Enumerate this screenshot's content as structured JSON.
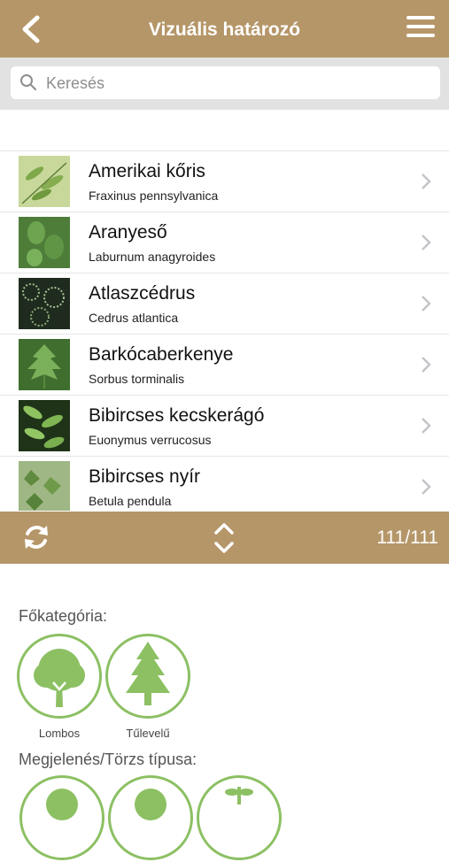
{
  "header": {
    "title": "Vizuális határozó",
    "back_icon": "chevron-left-icon",
    "menu_icon": "hamburger-menu-icon"
  },
  "search": {
    "placeholder": "Keresés"
  },
  "plants": [
    {
      "name": "Amerikai kőris",
      "latin": "Fraxinus pennsylvanica"
    },
    {
      "name": "Aranyeső",
      "latin": "Laburnum anagyroides"
    },
    {
      "name": "Atlaszcédrus",
      "latin": "Cedrus atlantica"
    },
    {
      "name": "Barkócaberkenye",
      "latin": "Sorbus torminalis"
    },
    {
      "name": "Bibircses kecskerágó",
      "latin": "Euonymus verrucosus"
    },
    {
      "name": "Bibircses nyír",
      "latin": "Betula pendula"
    }
  ],
  "toolbar": {
    "count": "111/111",
    "refresh_icon": "refresh-icon",
    "sort_icon": "up-down-arrows-icon"
  },
  "filters": {
    "main_category_label": "Főkategória:",
    "main_categories": [
      {
        "label": "Lombos",
        "icon": "deciduous-tree-icon"
      },
      {
        "label": "Tűlevelű",
        "icon": "conifer-tree-icon"
      }
    ],
    "appearance_label": "Megjelenés/Törzs típusa:"
  },
  "colors": {
    "brand": "#b59668",
    "accent_green": "#8cc063"
  }
}
